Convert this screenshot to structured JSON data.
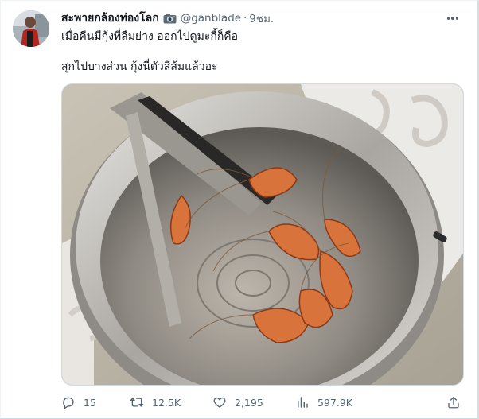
{
  "tweet": {
    "display_name": "สะพายกล้องท่องโลก",
    "handle": "@ganblade",
    "separator": "·",
    "time": "9ชม.",
    "text_line1": "เมื่อคืนมีกุ้งที่ลืมย่าง ออกไปดูมะกี้ก็คือ",
    "text_line2": "สุกไปบางส่วน กุ้งนี่ตัวสีส้มแล้วอะ"
  },
  "icons": {
    "name_badge": "camera-icon",
    "more": "more-horizontal-icon",
    "reply": "reply-icon",
    "retweet": "retweet-icon",
    "like": "like-heart-icon",
    "views": "views-bar-chart-icon",
    "share": "share-upload-icon"
  },
  "actions": {
    "replies": "15",
    "retweets": "12.5K",
    "likes": "2,195",
    "views": "597.9K"
  },
  "colors": {
    "text_primary": "#0f1419",
    "text_secondary": "#536471",
    "border": "#cfd9de"
  }
}
